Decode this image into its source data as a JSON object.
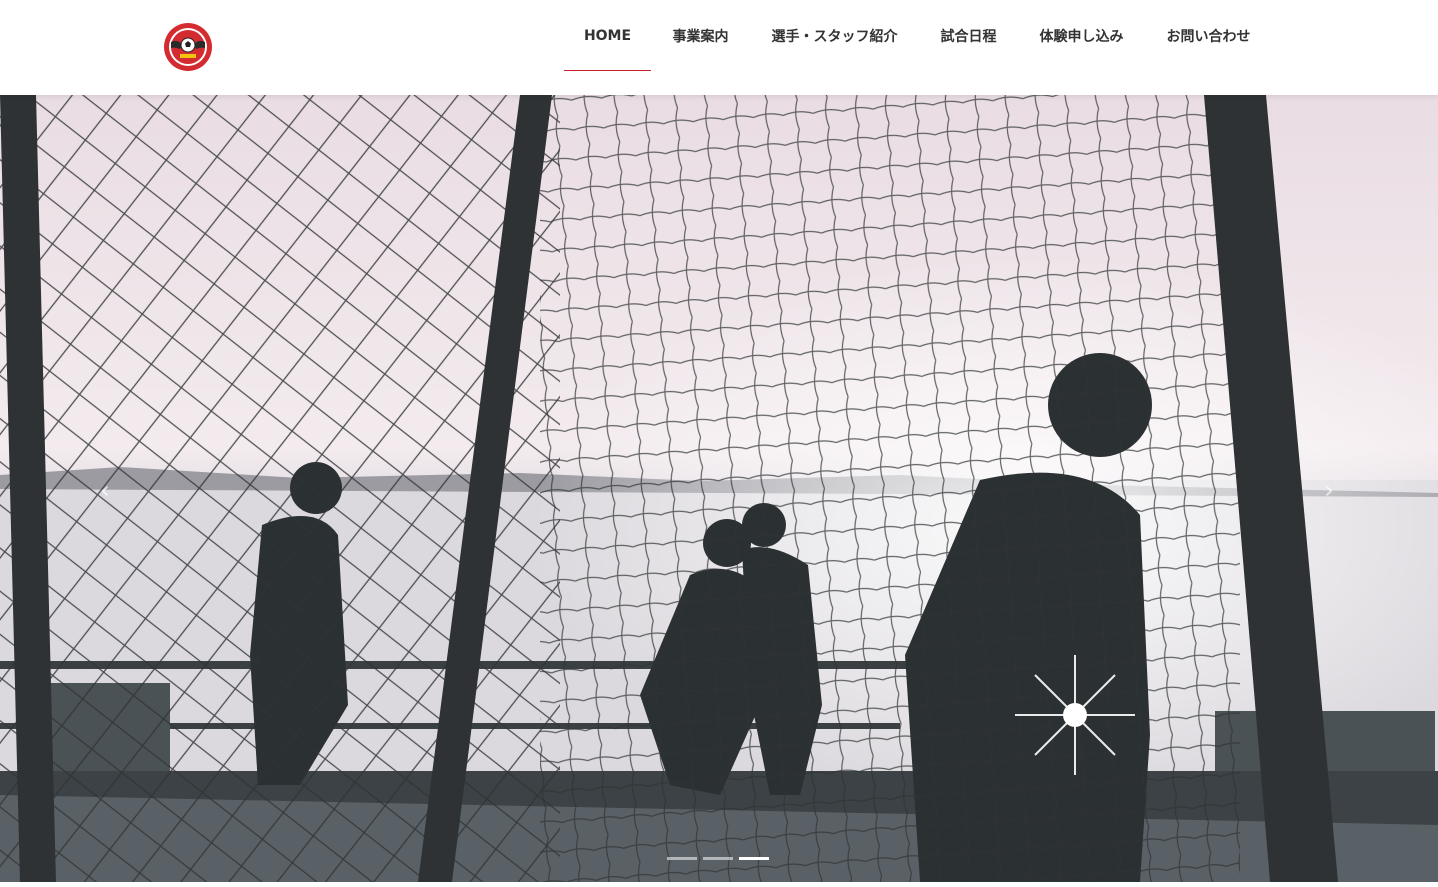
{
  "colors": {
    "accent": "#c8202a",
    "nav_text": "#333333",
    "header_bg": "#ffffff"
  },
  "header": {
    "logo": {
      "icon": "team-crest-icon"
    },
    "nav": [
      {
        "label": "HOME",
        "active": true
      },
      {
        "label": "事業案内",
        "active": false
      },
      {
        "label": "選手・スタッフ紹介",
        "active": false
      },
      {
        "label": "試合日程",
        "active": false
      },
      {
        "label": "体験申し込み",
        "active": false
      },
      {
        "label": "お問い合わせ",
        "active": false
      }
    ]
  },
  "hero": {
    "prev_icon": "‹",
    "next_icon": "›",
    "slide_count": 3,
    "active_slide": 3
  }
}
